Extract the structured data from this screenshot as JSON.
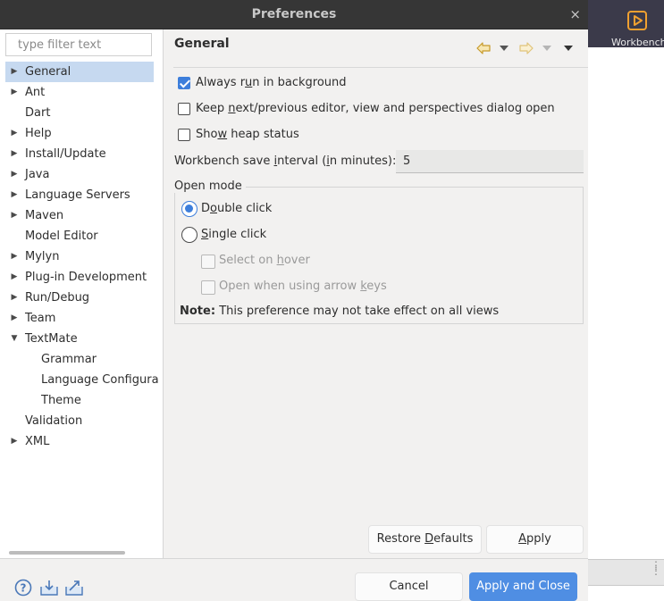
{
  "window": {
    "title": "Preferences",
    "close_glyph": "×"
  },
  "background_app": {
    "workbench_label": "Workbench",
    "icon": "play-icon"
  },
  "filter": {
    "placeholder": "type filter text"
  },
  "tree": {
    "items": [
      {
        "label": "General",
        "expandable": true,
        "selected": true
      },
      {
        "label": "Ant",
        "expandable": true
      },
      {
        "label": "Dart",
        "expandable": false
      },
      {
        "label": "Help",
        "expandable": true
      },
      {
        "label": "Install/Update",
        "expandable": true
      },
      {
        "label": "Java",
        "expandable": true
      },
      {
        "label": "Language Servers",
        "expandable": true
      },
      {
        "label": "Maven",
        "expandable": true
      },
      {
        "label": "Model Editor",
        "expandable": false
      },
      {
        "label": "Mylyn",
        "expandable": true
      },
      {
        "label": "Plug-in Development",
        "expandable": true
      },
      {
        "label": "Run/Debug",
        "expandable": true
      },
      {
        "label": "Team",
        "expandable": true
      },
      {
        "label": "TextMate",
        "expandable": true,
        "expanded": true
      },
      {
        "label": "Grammar",
        "child": true
      },
      {
        "label": "Language Configura",
        "child": true
      },
      {
        "label": "Theme",
        "child": true
      },
      {
        "label": "Validation",
        "expandable": false
      },
      {
        "label": "XML",
        "expandable": true
      }
    ]
  },
  "page": {
    "title": "General",
    "nav_icons": [
      "back-icon",
      "back-menu-icon",
      "forward-icon",
      "forward-menu-icon",
      "view-menu-icon"
    ],
    "always_run_background": {
      "pre": "Always r",
      "mn": "u",
      "post": "n in background",
      "checked": true
    },
    "keep_next_previous": {
      "pre": "Keep ",
      "mn": "n",
      "post": "ext/previous editor, view and perspectives dialog open",
      "checked": false
    },
    "show_heap_status": {
      "pre": "Sho",
      "mn": "w",
      "post": " heap status",
      "checked": false
    },
    "save_interval": {
      "pre": "Workbench save ",
      "mn": "i",
      "mid": "nterval (",
      "mn2": "i",
      "post": "n minutes):",
      "value": "5"
    },
    "open_mode": {
      "label": "Open mode",
      "double_click": {
        "pre": "D",
        "mn": "o",
        "post": "uble click",
        "selected": true
      },
      "single_click": {
        "pre": "",
        "mn": "S",
        "post": "ingle click",
        "selected": false
      },
      "select_on_hover": {
        "pre": "Select on ",
        "mn": "h",
        "post": "over",
        "enabled": false
      },
      "open_arrow_keys": {
        "pre": "Open when using arrow ",
        "mn": "k",
        "post": "eys",
        "enabled": false
      },
      "note_label": "Note:",
      "note_text": "This preference may not take effect on all views"
    },
    "buttons": {
      "restore_defaults": {
        "pre": "Restore ",
        "mn": "D",
        "post": "efaults"
      },
      "apply": {
        "pre": "",
        "mn": "A",
        "post": "pply"
      }
    }
  },
  "footer": {
    "icons": [
      "help-icon",
      "import-icon",
      "export-icon"
    ],
    "cancel": "Cancel",
    "apply_and_close": "Apply and Close"
  },
  "colors": {
    "accent": "#3d7edb",
    "selection": "#c6d9f0",
    "titlebar": "#363636"
  }
}
